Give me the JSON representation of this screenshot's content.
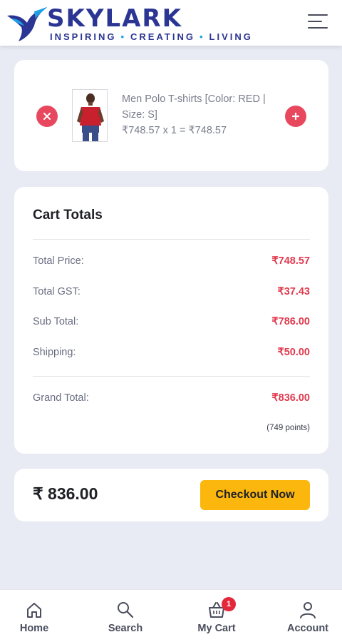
{
  "header": {
    "brand_name": "SKYLARK",
    "tagline_parts": [
      "INSPIRING",
      "CREATING",
      "LIVING"
    ],
    "logo_icon": "bird-icon",
    "menu_icon": "hamburger-menu-icon"
  },
  "cart_item": {
    "name": "Men Polo T-shirts [Color: RED | Size: S]",
    "price_line": "₹748.57 x 1 = ₹748.57",
    "remove_icon": "close-icon",
    "add_icon": "plus-icon"
  },
  "totals": {
    "title": "Cart Totals",
    "rows": [
      {
        "label": "Total Price:",
        "value": "₹748.57"
      },
      {
        "label": "Total GST:",
        "value": "₹37.43"
      },
      {
        "label": "Sub Total:",
        "value": "₹786.00"
      },
      {
        "label": "Shipping:",
        "value": "₹50.00"
      }
    ],
    "grand_total_label": "Grand Total:",
    "grand_total_value": "₹836.00",
    "points": "(749 points)"
  },
  "checkout": {
    "amount": "₹ 836.00",
    "button_label": "Checkout Now"
  },
  "bottom_nav": {
    "items": [
      {
        "label": "Home",
        "icon": "home-icon"
      },
      {
        "label": "Search",
        "icon": "search-icon"
      },
      {
        "label": "My Cart",
        "icon": "basket-icon",
        "badge": "1"
      },
      {
        "label": "Account",
        "icon": "user-icon"
      }
    ]
  },
  "colors": {
    "brand": "#2b3593",
    "accent_red": "#e8485e",
    "price_red": "#e03a4e",
    "checkout_yellow": "#fbb70e",
    "background": "#e8eaf4"
  }
}
